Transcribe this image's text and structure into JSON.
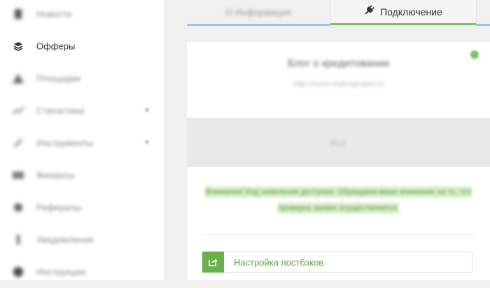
{
  "sidebar": {
    "items": [
      {
        "label": "Новости",
        "icon": "newspaper-icon",
        "has_chevron": false
      },
      {
        "label": "Офферы",
        "icon": "layers-icon",
        "has_chevron": false,
        "active": true
      },
      {
        "label": "Площадки",
        "icon": "sites-icon",
        "has_chevron": false
      },
      {
        "label": "Статистика",
        "icon": "chart-icon",
        "has_chevron": true
      },
      {
        "label": "Инструменты",
        "icon": "tools-icon",
        "has_chevron": true
      },
      {
        "label": "Финансы",
        "icon": "money-icon",
        "has_chevron": false
      },
      {
        "label": "Рефералы",
        "icon": "referrals-icon",
        "has_chevron": false
      },
      {
        "label": "Уведомления",
        "icon": "bell-icon",
        "has_chevron": false
      },
      {
        "label": "Инструкции",
        "icon": "help-icon",
        "has_chevron": false
      }
    ]
  },
  "tabs": {
    "info": {
      "label": "О Информация"
    },
    "connection": {
      "label": "Подключение",
      "icon": "plug-icon"
    }
  },
  "offer": {
    "title": "Блог о кредитовании",
    "url": "http://www.mylongsuper.ru",
    "status_color": "#7bc560"
  },
  "band": {
    "text": "Все"
  },
  "notice": {
    "text": "Внимание! Код заявления доступен. Обращаем ваше внимание на то, что проверка заявок осуществляется."
  },
  "postback": {
    "label": "Настройка постбэков",
    "icon": "external-link-icon"
  },
  "colors": {
    "accent_green": "#7bc560",
    "tab_blue": "#9ec3e8",
    "button_green": "#6ab04c"
  }
}
